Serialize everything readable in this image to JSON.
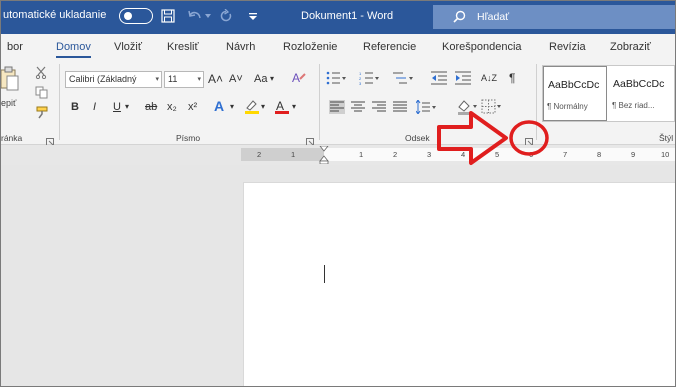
{
  "titlebar": {
    "autosave_label": "utomatické ukladanie",
    "doc_title": "Dokument1  -  Word",
    "search_text": "Hľadať",
    "autosave_state": "on"
  },
  "tabs": [
    {
      "label": "bor"
    },
    {
      "label": "Domov"
    },
    {
      "label": "Vložiť"
    },
    {
      "label": "Kresliť"
    },
    {
      "label": "Návrh"
    },
    {
      "label": "Rozloženie"
    },
    {
      "label": "Referencie"
    },
    {
      "label": "Korešpondencia"
    },
    {
      "label": "Revízia"
    },
    {
      "label": "Zobraziť"
    }
  ],
  "active_tab": "Domov",
  "ribbon": {
    "clipboard": {
      "paste_label": "epiť",
      "group_label": "ránka"
    },
    "font": {
      "font_name": "Calibri (Základný",
      "font_size": "11",
      "grow": "A˄",
      "shrink": "A˅",
      "case": "Aa",
      "bold": "B",
      "italic": "I",
      "underline": "U",
      "strike": "ab",
      "subscript": "x₂",
      "superscript": "x²",
      "group_label": "Písmo"
    },
    "paragraph": {
      "sort": "A↓Z",
      "pilcrow": "¶",
      "group_label": "Odsek"
    },
    "styles": {
      "items": [
        {
          "sample": "AaBbCcDc",
          "name": "¶ Normálny"
        },
        {
          "sample": "AaBbCcDc",
          "name": "¶ Bez riad..."
        }
      ],
      "group_label": "Štýl"
    }
  },
  "ruler": {
    "left_numbers": [
      "2",
      "1"
    ],
    "right_numbers": [
      "1",
      "2",
      "3",
      "4",
      "5",
      "6",
      "7",
      "8",
      "9",
      "10"
    ]
  },
  "colors": {
    "title_bg": "#2b579a",
    "search_bg": "#6d8fc4",
    "annotation_red": "#e01e1e",
    "highlight_yellow": "#ffd800",
    "font_color_red": "#e01e1e"
  }
}
